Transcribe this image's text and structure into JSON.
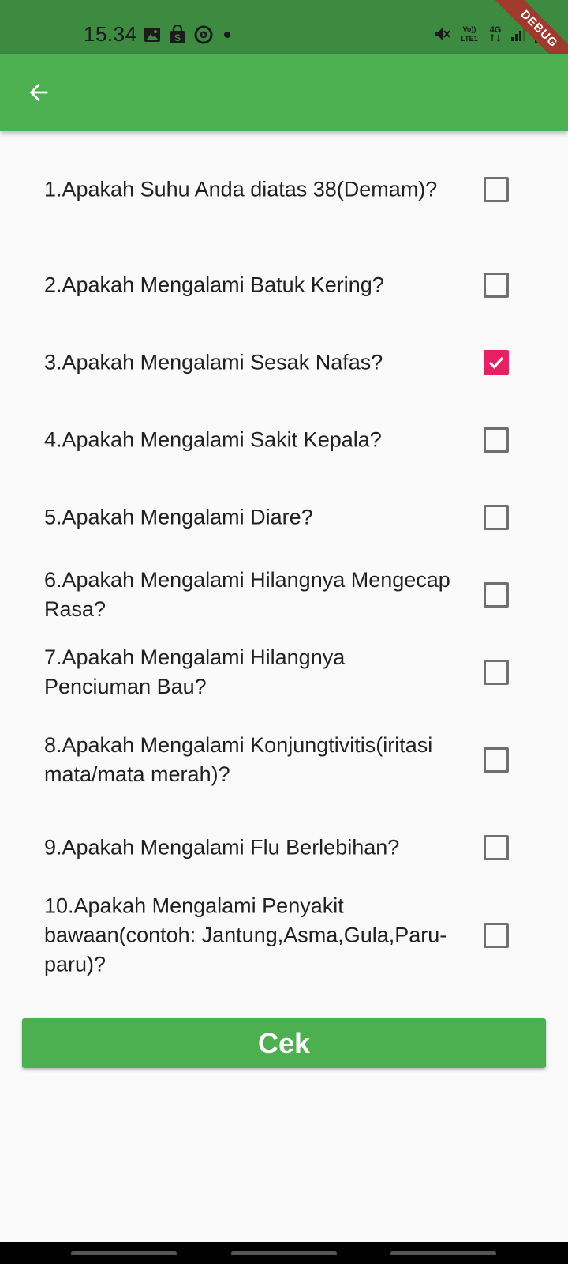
{
  "status_bar": {
    "time": "15.34",
    "left_icons": [
      "image-icon",
      "shopping-bag-icon",
      "circle-play-icon",
      "dot-icon"
    ],
    "right_icons": [
      "mute-icon",
      "volte-icon",
      "4g-icon",
      "signal-icon",
      "battery-icon"
    ],
    "volte_label": "Vo)) LTE1",
    "network_label": "4G",
    "debug_label": "DEBUG"
  },
  "app_bar": {
    "back_icon": "arrow-back-icon",
    "color": "#4caf50"
  },
  "questions": [
    {
      "text": "1.Apakah Suhu Anda diatas 38(Demam)?",
      "checked": false
    },
    {
      "text": "2.Apakah Mengalami Batuk Kering?",
      "checked": false
    },
    {
      "text": "3.Apakah Mengalami Sesak Nafas?",
      "checked": true
    },
    {
      "text": "4.Apakah Mengalami Sakit Kepala?",
      "checked": false
    },
    {
      "text": "5.Apakah Mengalami Diare?",
      "checked": false
    },
    {
      "text": "6.Apakah Mengalami Hilangnya Mengecap Rasa?",
      "checked": false
    },
    {
      "text": "7.Apakah Mengalami Hilangnya Penciuman Bau?",
      "checked": false
    },
    {
      "text": "8.Apakah Mengalami Konjungtivitis(iritasi mata/mata merah)?",
      "checked": false
    },
    {
      "text": "9.Apakah Mengalami Flu Berlebihan?",
      "checked": false
    },
    {
      "text": "10.Apakah Mengalami Penyakit bawaan(contoh: Jantung,Asma,Gula,Paru-paru)?",
      "checked": false
    }
  ],
  "submit_button": {
    "label": "Cek"
  },
  "colors": {
    "primary": "#4caf50",
    "status_bar": "#3d8b40",
    "checkbox_active": "#e91e63"
  }
}
